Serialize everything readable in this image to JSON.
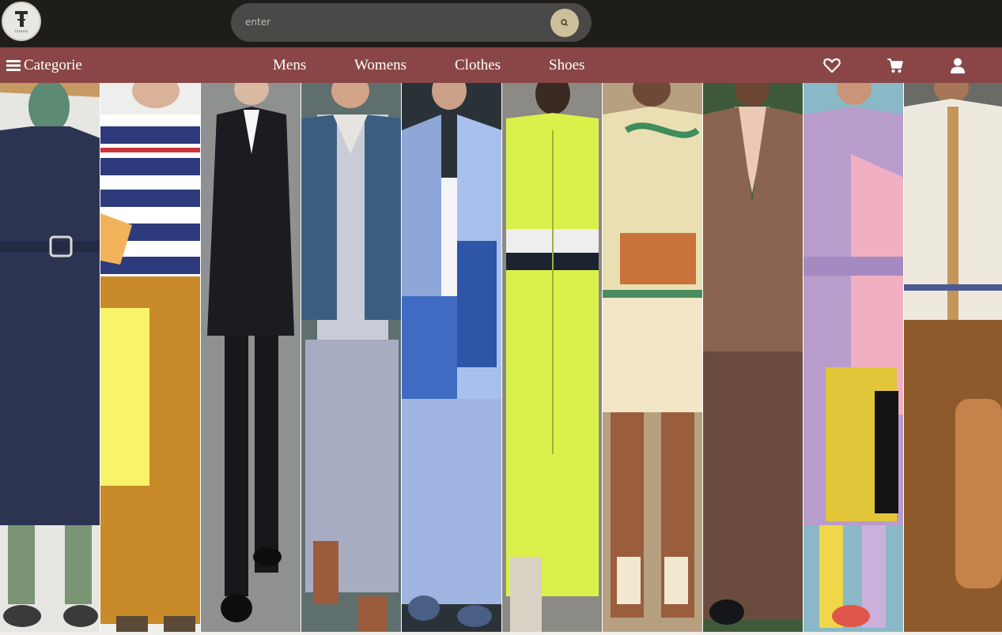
{
  "header": {
    "logo_text": "TIDIDS",
    "search": {
      "placeholder": "enter",
      "value": ""
    }
  },
  "nav": {
    "category_label": "Categorie",
    "links": [
      "Mens",
      "Womens",
      "Clothes",
      "Shoes"
    ],
    "icons": [
      "heart-icon",
      "cart-icon",
      "user-icon"
    ]
  },
  "gallery": {
    "panels": [
      {
        "name": "navy-trench-look"
      },
      {
        "name": "anchor-sweater-look"
      },
      {
        "name": "black-suit-look"
      },
      {
        "name": "denim-vest-look"
      },
      {
        "name": "blue-patchwork-look"
      },
      {
        "name": "neon-jumpsuit-look"
      },
      {
        "name": "tennis-sweater-look"
      },
      {
        "name": "brown-suit-look"
      },
      {
        "name": "lilac-trench-look"
      },
      {
        "name": "camel-cardigan-look"
      }
    ]
  },
  "colors": {
    "topbar": "#1f1d1a",
    "navbar": "#8a4646",
    "search_button": "#cdbf9b"
  }
}
